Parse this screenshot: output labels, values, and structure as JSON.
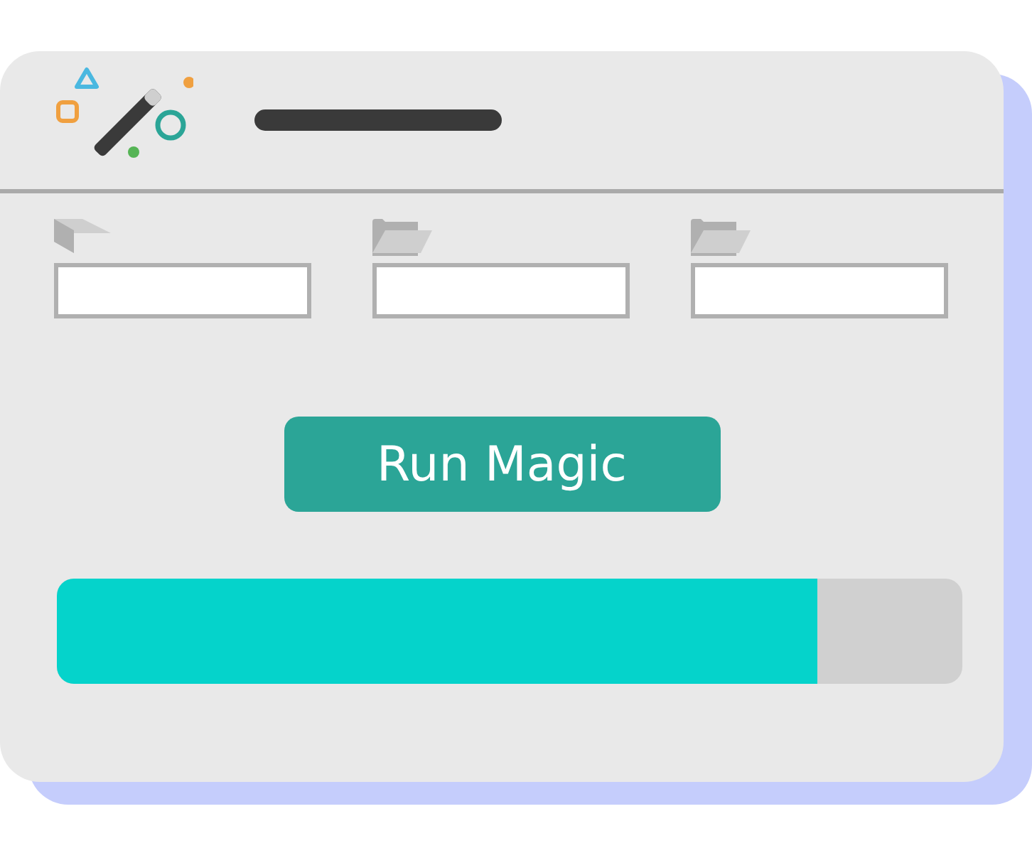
{
  "fields": [
    {
      "kind": "flag"
    },
    {
      "kind": "folder"
    },
    {
      "kind": "folder"
    }
  ],
  "button": {
    "label": "Run Magic"
  },
  "progress": {
    "level": 0.84
  }
}
